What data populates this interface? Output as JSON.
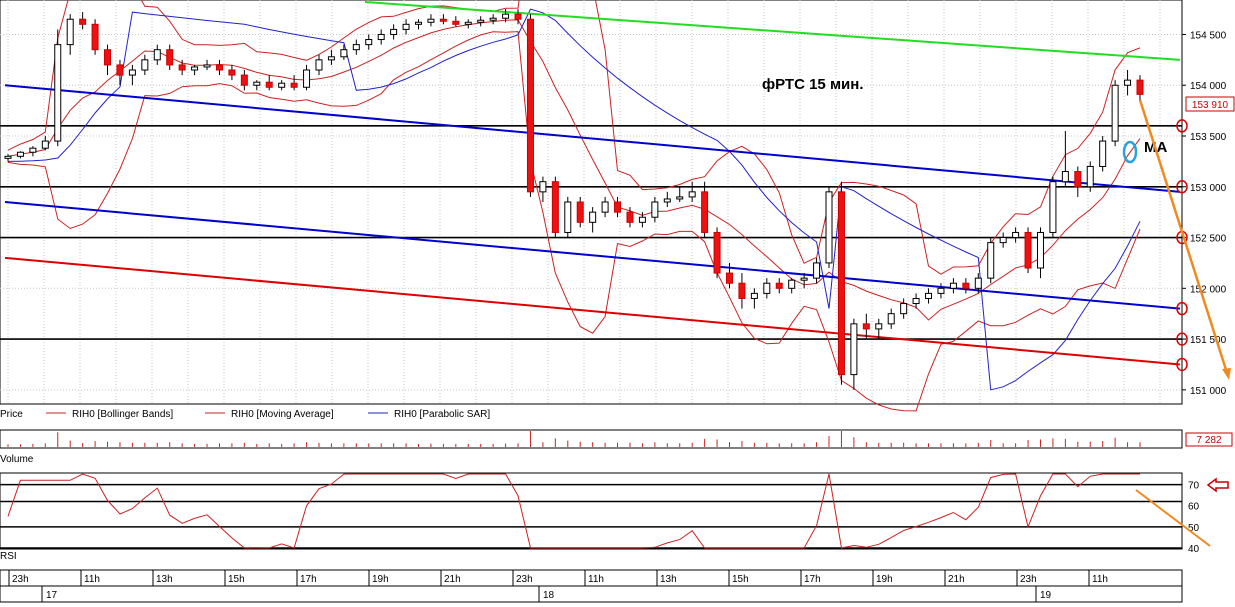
{
  "chart_data": {
    "type": "candlestick",
    "annotation_title": "фРТС   15 мин.",
    "annotation_ma": "MA",
    "price_axis": {
      "ylim": [
        150900,
        154800
      ],
      "ticks": [
        "154 500",
        "154 000",
        "153 500",
        "153 000",
        "152 500",
        "152 000",
        "151 500",
        "151 000"
      ]
    },
    "last_price_label": "153 910",
    "legend": [
      "Price",
      "RIH0 [Bollinger Bands]",
      "RIH0 [Moving Average]",
      "RIH0 [Parabolic SAR]"
    ],
    "volume": {
      "label": "Volume",
      "last_value_label": "7 282"
    },
    "rsi": {
      "label": "RSI",
      "ylim": [
        40,
        75
      ],
      "ticks": [
        "70",
        "60",
        "50",
        "40"
      ],
      "levels": [
        40,
        50,
        62,
        70
      ]
    },
    "time_axis": {
      "hour_labels": [
        "23h",
        "11h",
        "13h",
        "15h",
        "17h",
        "19h",
        "21h",
        "23h",
        "11h",
        "13h",
        "15h",
        "17h",
        "19h",
        "21h",
        "23h",
        "11h"
      ],
      "day_labels": [
        "17",
        "18",
        "19"
      ]
    },
    "horizontal_levels": [
      153600,
      153000,
      152500,
      151500
    ],
    "trend_lines": [
      {
        "color": "#22dd22",
        "points": [
          [
            365,
            154820
          ],
          [
            1180,
            154250
          ]
        ]
      },
      {
        "color": "#0000cc",
        "points": [
          [
            5,
            154000
          ],
          [
            1180,
            152950
          ]
        ]
      },
      {
        "color": "#0000cc",
        "points": [
          [
            5,
            152850
          ],
          [
            1180,
            151800
          ]
        ]
      },
      {
        "color": "#dd0000",
        "points": [
          [
            5,
            152300
          ],
          [
            1180,
            151250
          ]
        ]
      }
    ],
    "candles": [
      [
        153280,
        153320,
        153250,
        153300
      ],
      [
        153300,
        153350,
        153280,
        153340
      ],
      [
        153340,
        153400,
        153300,
        153380
      ],
      [
        153380,
        153500,
        153360,
        153450
      ],
      [
        153450,
        154550,
        153400,
        154400
      ],
      [
        154400,
        154700,
        154300,
        154650
      ],
      [
        154650,
        154720,
        154550,
        154600
      ],
      [
        154600,
        154650,
        154300,
        154350
      ],
      [
        154350,
        154400,
        154100,
        154200
      ],
      [
        154200,
        154250,
        154000,
        154100
      ],
      [
        154100,
        154200,
        154000,
        154150
      ],
      [
        154150,
        154300,
        154100,
        154250
      ],
      [
        154250,
        154400,
        154200,
        154350
      ],
      [
        154350,
        154400,
        154150,
        154200
      ],
      [
        154200,
        154250,
        154100,
        154150
      ],
      [
        154150,
        154200,
        154100,
        154180
      ],
      [
        154180,
        154250,
        154150,
        154200
      ],
      [
        154200,
        154250,
        154100,
        154150
      ],
      [
        154150,
        154200,
        154050,
        154100
      ],
      [
        154100,
        154150,
        153950,
        154000
      ],
      [
        154000,
        154050,
        153950,
        154030
      ],
      [
        154030,
        154100,
        153950,
        153980
      ],
      [
        153980,
        154050,
        153950,
        154020
      ],
      [
        154020,
        154100,
        153950,
        153980
      ],
      [
        153980,
        154200,
        153950,
        154150
      ],
      [
        154150,
        154300,
        154100,
        154250
      ],
      [
        154250,
        154350,
        154200,
        154280
      ],
      [
        154280,
        154400,
        154250,
        154350
      ],
      [
        154350,
        154450,
        154300,
        154400
      ],
      [
        154400,
        154500,
        154350,
        154450
      ],
      [
        154450,
        154550,
        154400,
        154500
      ],
      [
        154500,
        154600,
        154450,
        154550
      ],
      [
        154550,
        154650,
        154500,
        154600
      ],
      [
        154600,
        154650,
        154550,
        154620
      ],
      [
        154620,
        154700,
        154580,
        154650
      ],
      [
        154650,
        154700,
        154600,
        154630
      ],
      [
        154630,
        154680,
        154580,
        154600
      ],
      [
        154600,
        154650,
        154560,
        154620
      ],
      [
        154620,
        154680,
        154580,
        154640
      ],
      [
        154640,
        154700,
        154600,
        154660
      ],
      [
        154660,
        154750,
        154620,
        154700
      ],
      [
        154700,
        154750,
        154600,
        154650
      ],
      [
        154650,
        154700,
        152900,
        152950
      ],
      [
        152950,
        153100,
        152850,
        153050
      ],
      [
        153050,
        153100,
        152500,
        152550
      ],
      [
        152550,
        152900,
        152500,
        152850
      ],
      [
        152850,
        152900,
        152600,
        152650
      ],
      [
        152650,
        152800,
        152550,
        152750
      ],
      [
        152750,
        152900,
        152700,
        152850
      ],
      [
        152850,
        152900,
        152700,
        152750
      ],
      [
        152750,
        152800,
        152600,
        152650
      ],
      [
        152650,
        152750,
        152600,
        152700
      ],
      [
        152700,
        152900,
        152650,
        152850
      ],
      [
        152850,
        152950,
        152800,
        152880
      ],
      [
        152880,
        153000,
        152850,
        152900
      ],
      [
        152900,
        153050,
        152850,
        152950
      ],
      [
        152950,
        153050,
        152500,
        152550
      ],
      [
        152550,
        152600,
        152100,
        152150
      ],
      [
        152150,
        152250,
        152000,
        152050
      ],
      [
        152050,
        152150,
        151800,
        151900
      ],
      [
        151900,
        152000,
        151800,
        151950
      ],
      [
        151950,
        152100,
        151900,
        152050
      ],
      [
        152050,
        152100,
        151950,
        152000
      ],
      [
        152000,
        152100,
        151950,
        152080
      ],
      [
        152080,
        152150,
        152000,
        152100
      ],
      [
        152100,
        152300,
        152050,
        152250
      ],
      [
        152250,
        153000,
        152200,
        152950
      ],
      [
        152950,
        153050,
        151050,
        151150
      ],
      [
        151150,
        151700,
        151000,
        151650
      ],
      [
        151650,
        151750,
        151500,
        151600
      ],
      [
        151600,
        151700,
        151500,
        151650
      ],
      [
        151650,
        151800,
        151600,
        151750
      ],
      [
        151750,
        151900,
        151700,
        151850
      ],
      [
        151850,
        151950,
        151800,
        151900
      ],
      [
        151900,
        152000,
        151850,
        151950
      ],
      [
        151950,
        152050,
        151900,
        152000
      ],
      [
        152000,
        152100,
        151950,
        152050
      ],
      [
        152050,
        152100,
        151950,
        152000
      ],
      [
        152000,
        152150,
        151950,
        152100
      ],
      [
        152100,
        152500,
        152050,
        152450
      ],
      [
        152450,
        152550,
        152400,
        152500
      ],
      [
        152500,
        152600,
        152450,
        152550
      ],
      [
        152550,
        152600,
        152150,
        152200
      ],
      [
        152200,
        152600,
        152100,
        152550
      ],
      [
        152550,
        153100,
        152500,
        153050
      ],
      [
        153050,
        153550,
        153000,
        153150
      ],
      [
        153150,
        153200,
        152900,
        153000
      ],
      [
        153000,
        153250,
        152950,
        153200
      ],
      [
        153200,
        153500,
        153150,
        153450
      ],
      [
        153450,
        154050,
        153400,
        154000
      ],
      [
        154000,
        154150,
        153900,
        154050
      ],
      [
        154050,
        154100,
        153850,
        153910
      ]
    ]
  }
}
